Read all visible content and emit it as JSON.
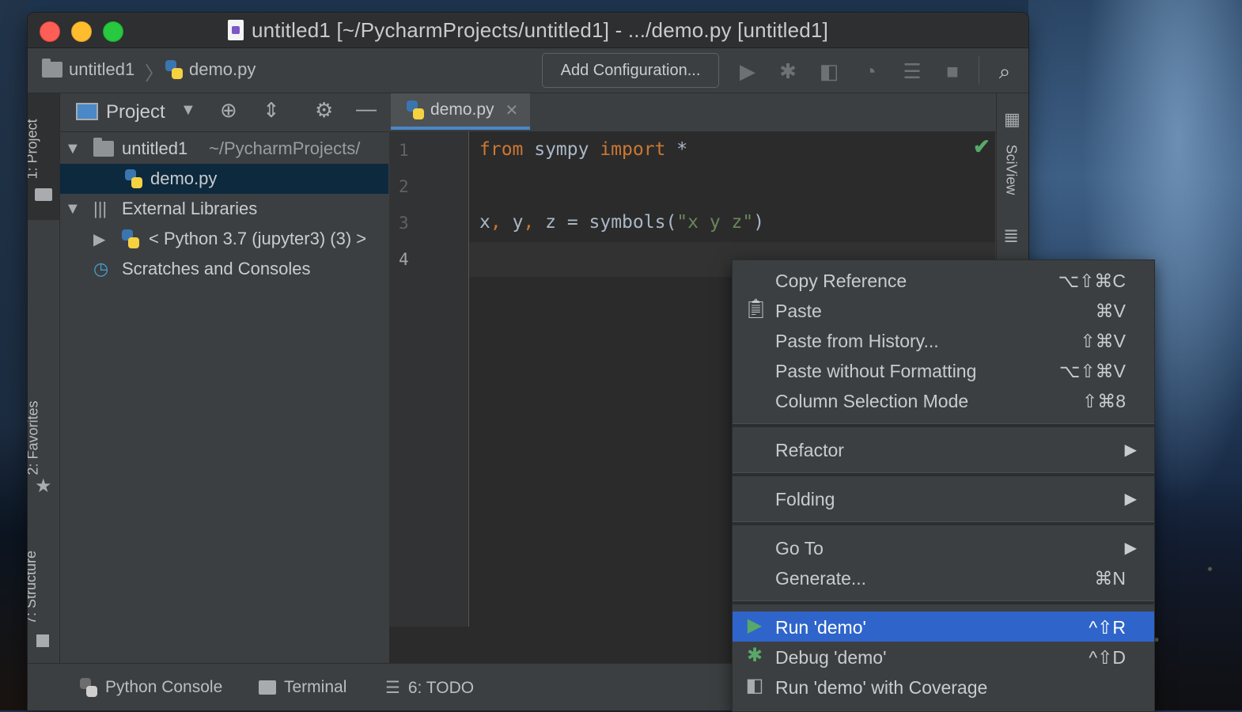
{
  "window": {
    "title": "untitled1 [~/PycharmProjects/untitled1] - .../demo.py [untitled1]"
  },
  "navbar": {
    "crumbs": [
      "untitled1",
      "demo.py"
    ],
    "add_config_label": "Add Configuration..."
  },
  "left_tabs": {
    "project": "1: Project",
    "favorites": "2: Favorites",
    "structure": "7: Structure"
  },
  "right_tabs": {
    "sciview": "SciView"
  },
  "project_panel": {
    "title": "Project",
    "tree": [
      {
        "label": "untitled1",
        "path": "~/PycharmProjects/"
      },
      {
        "label": "demo.py"
      },
      {
        "label": "External Libraries"
      },
      {
        "label": "< Python 3.7 (jupyter3) (3) >"
      },
      {
        "label": "Scratches and Consoles"
      }
    ]
  },
  "editor": {
    "tab_label": "demo.py",
    "line_numbers": [
      "1",
      "2",
      "3",
      "4"
    ],
    "code": {
      "l1_kw1": "from",
      "l1_mod": " sympy ",
      "l1_kw2": "import",
      "l1_rest": " *",
      "l3_a": "x",
      "l3_c1": ",",
      "l3_b": " y",
      "l3_c2": ",",
      "l3_rest": " z = symbols(",
      "l3_str": "\"x y z\"",
      "l3_end": ")"
    }
  },
  "bottom_bar": {
    "python_console": "Python Console",
    "terminal": "Terminal",
    "todo": "6: TODO"
  },
  "context_menu": {
    "items": [
      {
        "label": "Copy Reference",
        "shortcut": "⌥⇧⌘C"
      },
      {
        "label": "Paste",
        "shortcut": "⌘V"
      },
      {
        "label": "Paste from History...",
        "shortcut": "⇧⌘V"
      },
      {
        "label": "Paste without Formatting",
        "shortcut": "⌥⇧⌘V"
      },
      {
        "label": "Column Selection Mode",
        "shortcut": "⇧⌘8"
      },
      {
        "label": "Refactor",
        "shortcut": ""
      },
      {
        "label": "Folding",
        "shortcut": ""
      },
      {
        "label": "Go To",
        "shortcut": ""
      },
      {
        "label": "Generate...",
        "shortcut": "⌘N"
      },
      {
        "label": "Run 'demo'",
        "shortcut": "^⇧R"
      },
      {
        "label": "Debug 'demo'",
        "shortcut": "^⇧D"
      },
      {
        "label": "Run 'demo' with Coverage",
        "shortcut": ""
      }
    ],
    "highlight_color": "#2f65ca"
  }
}
